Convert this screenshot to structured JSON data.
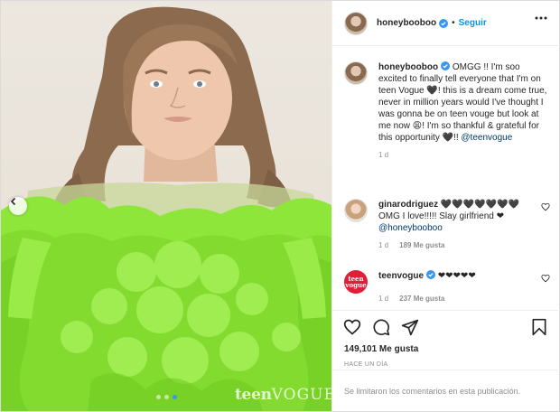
{
  "post": {
    "username": "honeybooboo",
    "separator": "•",
    "follow_label": "Seguir",
    "more_icon": "more-horizontal-icon",
    "caption": {
      "username": "honeybooboo",
      "text": "OMGG !! I'm soo excited to finally tell everyone that I'm on teen Vogue 🖤! this is a dream come true, never in million years would I've thought I was gonna be on teen vouge but look at me now 😩! I'm so thankful & grateful for this opportunity 🖤!! ",
      "mention": "@teenvogue",
      "time": "1 d"
    },
    "comments": [
      {
        "username": "ginarodriguez",
        "text": "🖤🖤🖤🖤🖤🖤🖤 OMG I love!!!!! Slay girlfriend ❤",
        "mention": "@honeybooboo",
        "time": "1 d",
        "likes": "189 Me gusta"
      },
      {
        "username": "teenvogue",
        "text": "❤❤❤❤❤",
        "time": "1 d",
        "likes": "237 Me gusta",
        "avatar_text": "teen vogue"
      }
    ],
    "likes_label": "149,101 Me gusta",
    "date_label": "HACE UN DÍA",
    "comments_disabled": "Se limitaron los comentarios en esta publicación.",
    "watermark_bold": "teen",
    "watermark_thin": "VOGUE"
  },
  "colors": {
    "accent": "#0095f6",
    "verified": "#3897f0",
    "dress": "#8ee63a",
    "teenvogue_red": "#e01e37"
  }
}
